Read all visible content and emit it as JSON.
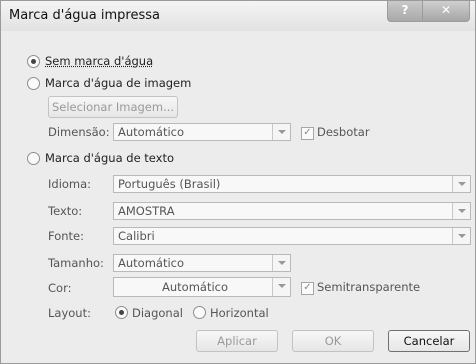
{
  "window": {
    "title": "Marca d'água impressa",
    "help_icon": "question-icon",
    "close_icon": "close-x-icon"
  },
  "options": {
    "none_label": "Sem marca d'água",
    "image_label": "Marca d'água de imagem",
    "text_label": "Marca d'água de texto",
    "selected": "none"
  },
  "image": {
    "select_button": "Selecionar Imagem...",
    "dimension_label": "Dimensão:",
    "dimension_value": "Automático",
    "washout_label": "Desbotar",
    "washout_checked": true
  },
  "text": {
    "language_label": "Idioma:",
    "language_value": "Português (Brasil)",
    "text_label": "Texto:",
    "text_value": "AMOSTRA",
    "font_label": "Fonte:",
    "font_value": "Calibri",
    "size_label": "Tamanho:",
    "size_value": "Automático",
    "color_label": "Cor:",
    "color_value": "Automático",
    "semitransparent_label": "Semitransparente",
    "semitransparent_checked": true,
    "layout_label": "Layout:",
    "layout_diagonal": "Diagonal",
    "layout_horizontal": "Horizontal",
    "layout_selected": "Diagonal"
  },
  "buttons": {
    "apply": "Aplicar",
    "ok": "OK",
    "cancel": "Cancelar"
  }
}
